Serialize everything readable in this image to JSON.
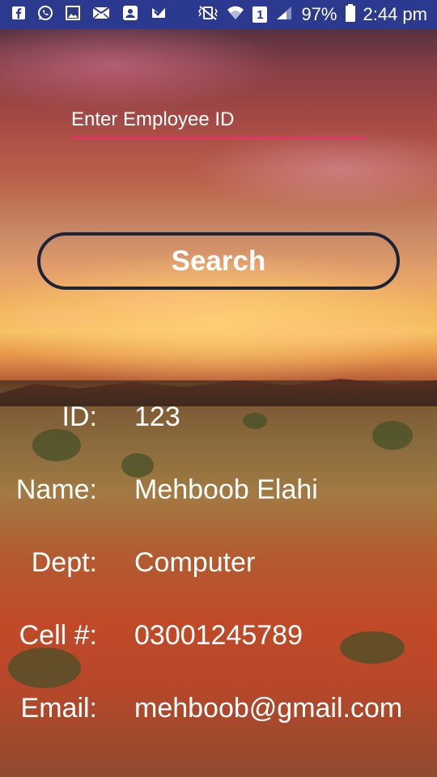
{
  "status_bar": {
    "battery": "97%",
    "time": "2:44 pm",
    "sim_slot": "1",
    "left_icons": [
      "facebook-icon",
      "whatsapp-icon",
      "gallery-icon",
      "mail-icon",
      "contacts-sync-icon",
      "inbox-check-icon"
    ],
    "right_icons": [
      "vibrate-icon",
      "wifi-icon",
      "sim-icon",
      "signal-icon",
      "battery-icon"
    ]
  },
  "search_form": {
    "placeholder": "Enter Employee ID",
    "value": "",
    "button_label": "Search"
  },
  "employee": {
    "id_label": "ID:",
    "id_value": "123",
    "name_label": "Name:",
    "name_value": "Mehboob Elahi",
    "dept_label": "Dept:",
    "dept_value": "Computer",
    "cell_label": "Cell #:",
    "cell_value": "03001245789",
    "email_label": "Email:",
    "email_value": "mehboob@gmail.com"
  },
  "colors": {
    "status_bar_bg": "#2b3a8f",
    "input_underline": "#e8326a",
    "button_border": "#1e2438",
    "text": "#ffffff"
  }
}
